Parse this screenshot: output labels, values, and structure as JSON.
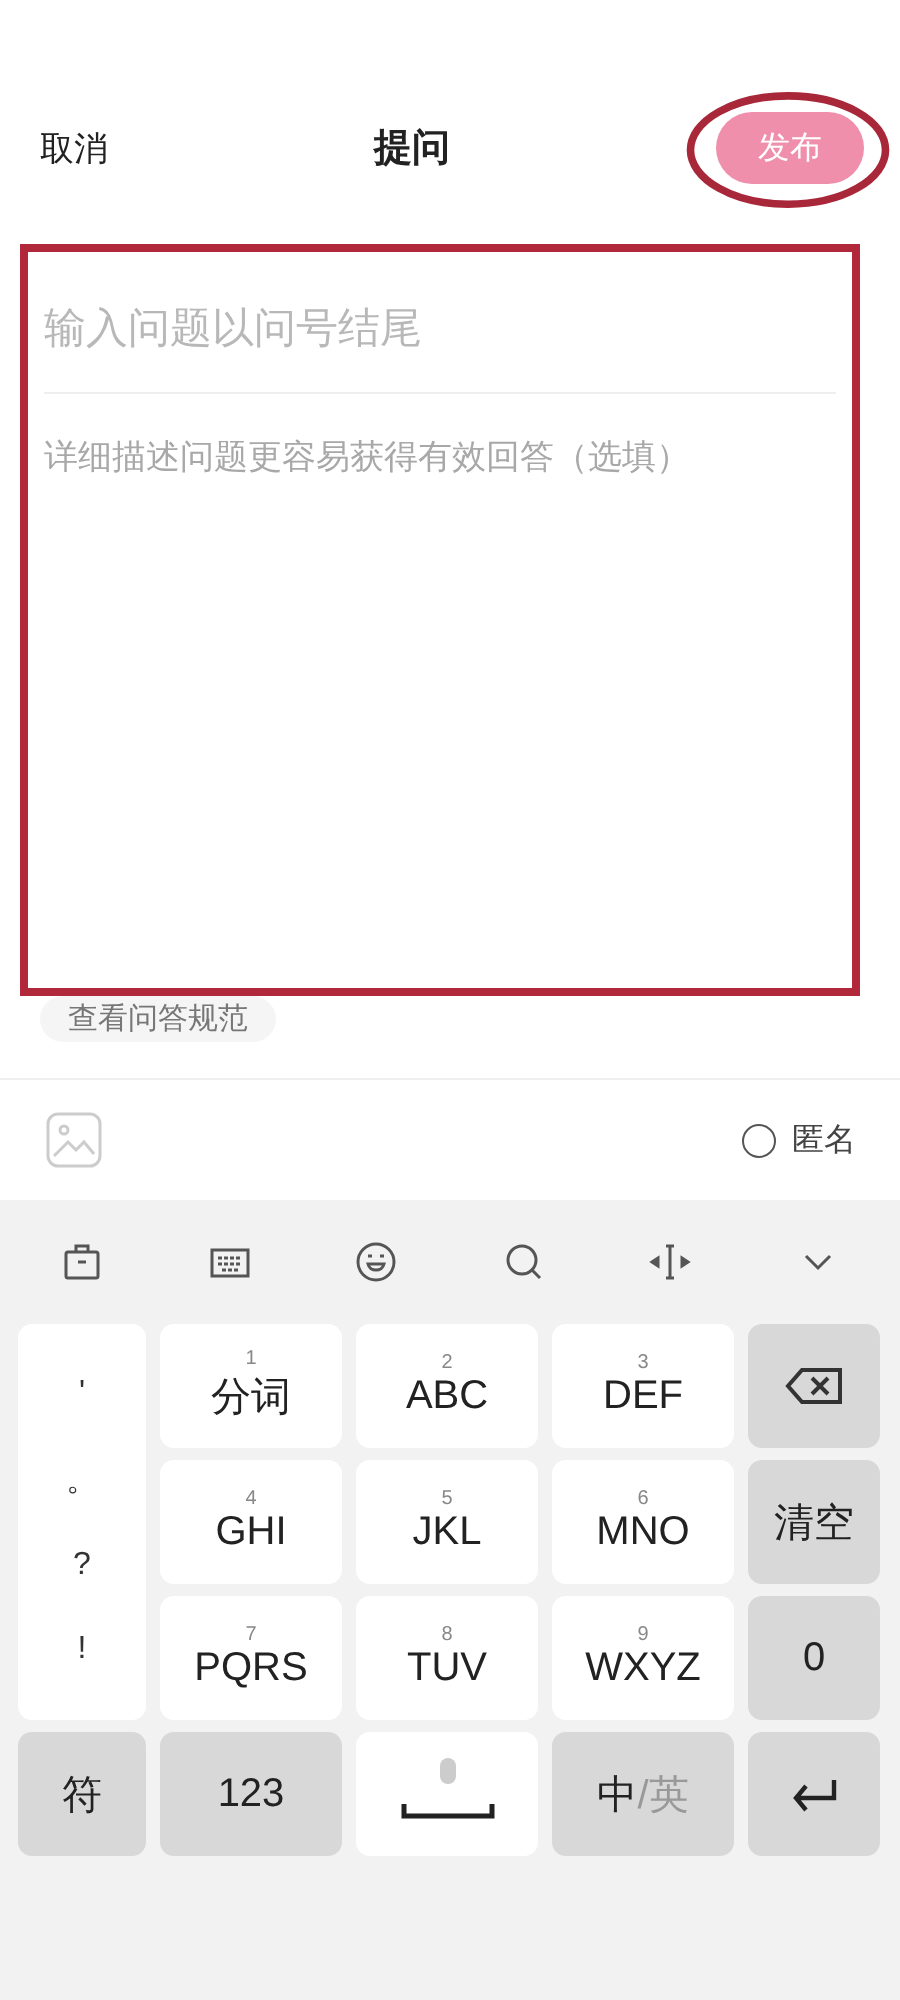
{
  "header": {
    "cancel": "取消",
    "title": "提问",
    "publish": {
      "label": "发布",
      "disabled": true
    }
  },
  "form": {
    "title_placeholder": "输入问题以问号结尾",
    "detail_placeholder": "详细描述问题更容易获得有效回答（选填）"
  },
  "guide_link": "查看问答规范",
  "anonymous": {
    "label": "匿名",
    "checked": false
  },
  "keyboard": {
    "punctuation": [
      "'",
      "。",
      "?",
      "!"
    ],
    "letter_keys": [
      {
        "digit": "1",
        "label": "分词"
      },
      {
        "digit": "2",
        "label": "ABC"
      },
      {
        "digit": "3",
        "label": "DEF"
      },
      {
        "digit": "4",
        "label": "GHI"
      },
      {
        "digit": "5",
        "label": "JKL"
      },
      {
        "digit": "6",
        "label": "MNO"
      },
      {
        "digit": "7",
        "label": "PQRS"
      },
      {
        "digit": "8",
        "label": "TUV"
      },
      {
        "digit": "9",
        "label": "WXYZ"
      }
    ],
    "side_keys": [
      {
        "kind": "backspace"
      },
      {
        "kind": "text",
        "label": "清空"
      },
      {
        "kind": "text",
        "label": "0"
      }
    ],
    "bottom_keys": [
      {
        "kind": "text",
        "label": "符",
        "dark": true
      },
      {
        "kind": "text",
        "label": "123",
        "dark": true
      },
      {
        "kind": "space",
        "dark": false
      },
      {
        "kind": "lang",
        "label": "中",
        "alt": "/英",
        "dark": true
      },
      {
        "kind": "enter",
        "dark": true
      }
    ]
  }
}
